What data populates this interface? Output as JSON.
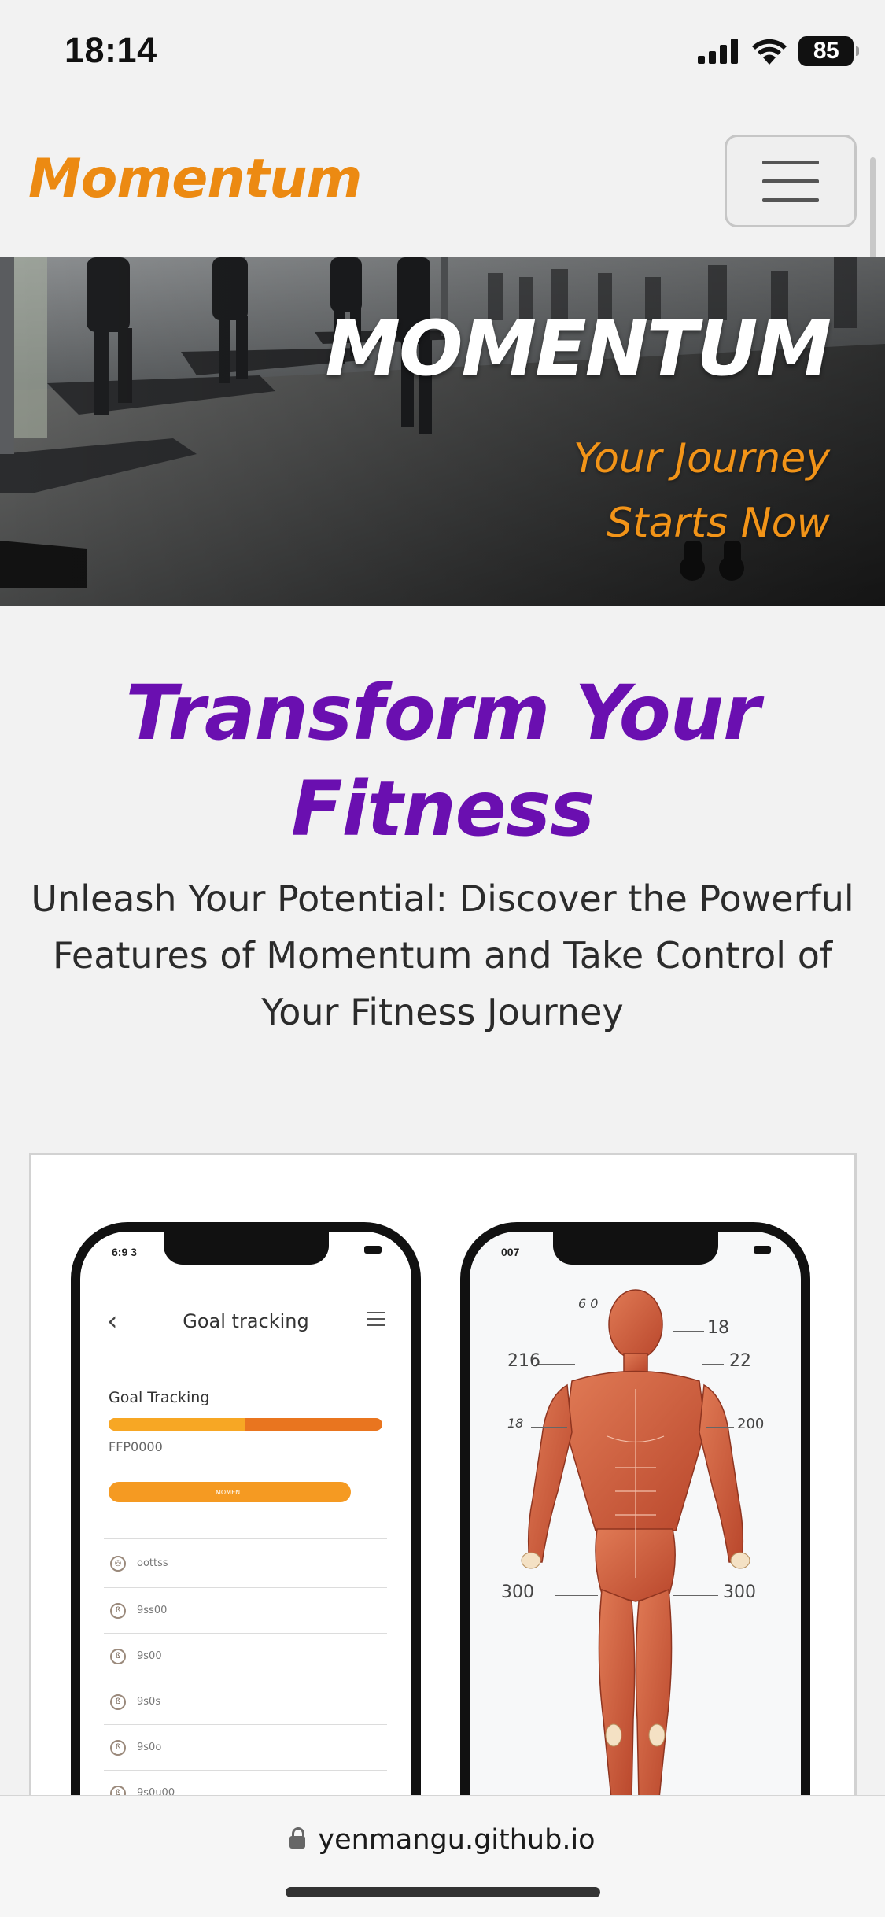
{
  "status_bar": {
    "time": "18:14",
    "battery": "85",
    "icons": [
      "cellular-signal-icon",
      "wifi-icon",
      "battery-icon"
    ]
  },
  "navbar": {
    "brand": "Momentum",
    "menu_icon": "hamburger-menu-icon",
    "brand_color": "#ec8a12"
  },
  "hero": {
    "title": "MOMENTUM",
    "subtitle_line1": "Your Journey",
    "subtitle_line2": "Starts Now",
    "subtitle_color": "#f29418"
  },
  "intro": {
    "title_line1": "Transform Your",
    "title_line2": "Fitness",
    "title_color": "#6a0fb0",
    "description": "Unleash Your Potential: Discover the Powerful Features of Momentum and Take Control of Your Fitness Journey"
  },
  "feature_card": {
    "goal_phone": {
      "status_time": "6:9 3",
      "screen_title": "Goal tracking",
      "section_label": "Goal Tracking",
      "progress": 0.5,
      "code": "FFP0000",
      "button_label": "MOMENT",
      "list_items": [
        "oottss",
        "9ss00",
        "9s00",
        "9s0s",
        "9s0o",
        "9s0u00"
      ]
    },
    "anatomy_phone": {
      "status_time": "007",
      "labels": {
        "top": "6 0",
        "top_right": "18",
        "left_shoulder": "216",
        "right_shoulder": "22",
        "left_chest": "18",
        "right_chest": "200",
        "left_thigh": "300",
        "right_thigh": "300"
      }
    }
  },
  "browser": {
    "url": "yenmangu.github.io",
    "lock_icon": "lock-icon"
  }
}
